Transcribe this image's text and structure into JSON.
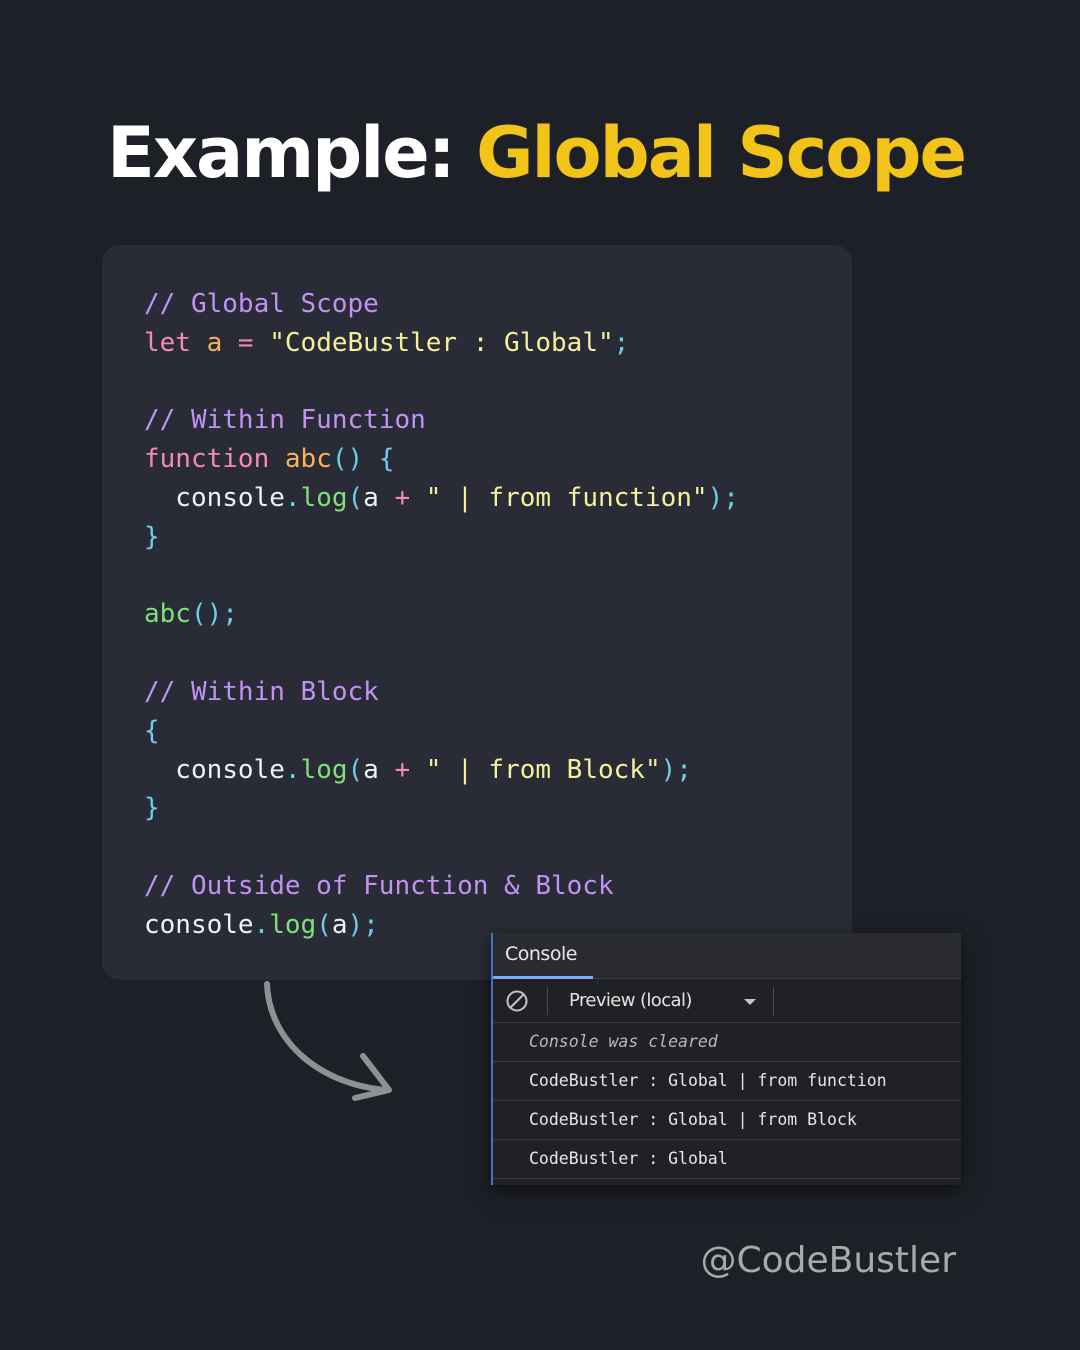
{
  "title": {
    "plain": "Example: ",
    "accent": "Global Scope"
  },
  "code": {
    "lines": [
      [
        {
          "t": "// Global Scope",
          "c": "cm"
        }
      ],
      [
        {
          "t": "let",
          "c": "kw"
        },
        {
          "t": " ",
          "c": "id"
        },
        {
          "t": "a",
          "c": "var"
        },
        {
          "t": " = ",
          "c": "op"
        },
        {
          "t": "\"CodeBustler : Global\"",
          "c": "str"
        },
        {
          "t": ";",
          "c": "pn"
        }
      ],
      [],
      [
        {
          "t": "// Within Function",
          "c": "cm"
        }
      ],
      [
        {
          "t": "function",
          "c": "kw"
        },
        {
          "t": " ",
          "c": "id"
        },
        {
          "t": "abc",
          "c": "fn"
        },
        {
          "t": "() {",
          "c": "pn"
        }
      ],
      [
        {
          "t": "  console",
          "c": "id"
        },
        {
          "t": ".",
          "c": "pn"
        },
        {
          "t": "log",
          "c": "meth"
        },
        {
          "t": "(",
          "c": "pn"
        },
        {
          "t": "a",
          "c": "id"
        },
        {
          "t": " + ",
          "c": "op"
        },
        {
          "t": "\" | from function\"",
          "c": "str"
        },
        {
          "t": ");",
          "c": "pn"
        }
      ],
      [
        {
          "t": "}",
          "c": "pn"
        }
      ],
      [],
      [
        {
          "t": "abc",
          "c": "call"
        },
        {
          "t": "();",
          "c": "pn"
        }
      ],
      [],
      [
        {
          "t": "// Within Block",
          "c": "cm"
        }
      ],
      [
        {
          "t": "{",
          "c": "pn"
        }
      ],
      [
        {
          "t": "  console",
          "c": "id"
        },
        {
          "t": ".",
          "c": "pn"
        },
        {
          "t": "log",
          "c": "meth"
        },
        {
          "t": "(",
          "c": "pn"
        },
        {
          "t": "a",
          "c": "id"
        },
        {
          "t": " + ",
          "c": "op"
        },
        {
          "t": "\" | from Block\"",
          "c": "str"
        },
        {
          "t": ");",
          "c": "pn"
        }
      ],
      [
        {
          "t": "}",
          "c": "pn"
        }
      ],
      [],
      [
        {
          "t": "// Outside of Function & Block",
          "c": "cm"
        }
      ],
      [
        {
          "t": "console",
          "c": "id"
        },
        {
          "t": ".",
          "c": "pn"
        },
        {
          "t": "log",
          "c": "meth"
        },
        {
          "t": "(",
          "c": "pn"
        },
        {
          "t": "a",
          "c": "id"
        },
        {
          "t": ");",
          "c": "pn"
        }
      ]
    ]
  },
  "console": {
    "tab_label": "Console",
    "context_label": "Preview (local)",
    "icons": {
      "clear": "clear-console-icon",
      "dropdown": "dropdown-caret-icon"
    },
    "messages": [
      {
        "text": "Console was cleared",
        "kind": "info"
      },
      {
        "text": "CodeBustler : Global | from function",
        "kind": "log"
      },
      {
        "text": "CodeBustler : Global | from Block",
        "kind": "log"
      },
      {
        "text": "CodeBustler : Global",
        "kind": "log"
      }
    ]
  },
  "handle": "@CodeBustler",
  "colors": {
    "background": "#1d2027",
    "card": "#292c36",
    "accent": "#f2c318",
    "comment": "#c192f0",
    "keyword": "#f28bb0",
    "string": "#f5ee9a",
    "method": "#7fe07a",
    "punctuation": "#6ccfe8"
  }
}
